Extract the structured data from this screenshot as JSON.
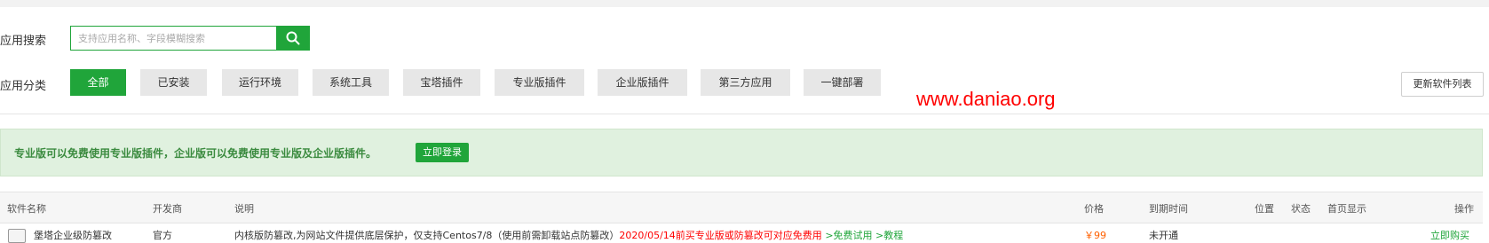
{
  "search": {
    "label": "应用搜索",
    "placeholder": "支持应用名称、字段模糊搜索"
  },
  "category": {
    "label": "应用分类",
    "items": [
      {
        "label": "全部",
        "active": true
      },
      {
        "label": "已安装",
        "active": false
      },
      {
        "label": "运行环境",
        "active": false
      },
      {
        "label": "系统工具",
        "active": false
      },
      {
        "label": "宝塔插件",
        "active": false
      },
      {
        "label": "专业版插件",
        "active": false
      },
      {
        "label": "企业版插件",
        "active": false
      },
      {
        "label": "第三方应用",
        "active": false
      },
      {
        "label": "一键部署",
        "active": false
      }
    ]
  },
  "update_button": "更新软件列表",
  "watermark": "www.daniao.org",
  "notice": {
    "text": "专业版可以免费使用专业版插件，企业版可以免费使用专业版及企业版插件。",
    "login_label": "立即登录"
  },
  "table": {
    "headers": [
      "软件名称",
      "开发商",
      "说明",
      "价格",
      "到期时间",
      "位置",
      "状态",
      "首页显示",
      "操作"
    ],
    "rows": [
      {
        "name": "堡塔企业级防篡改",
        "vendor": "官方",
        "desc": "内核版防篡改,为网站文件提供底层保护，仅支持Centos7/8（使用前需卸载站点防篡改）",
        "promo": "2020/05/14前买专业版或防篡改可对应免费用",
        "trial": ">免费试用",
        "tutorial": ">教程",
        "price": "￥99",
        "expire": "未开通",
        "action": "立即购买"
      }
    ]
  },
  "colors": {
    "accent": "#20a53a",
    "notice_bg": "#e0f1df",
    "promo_red": "#ff0000",
    "price_orange": "#ff6000"
  }
}
